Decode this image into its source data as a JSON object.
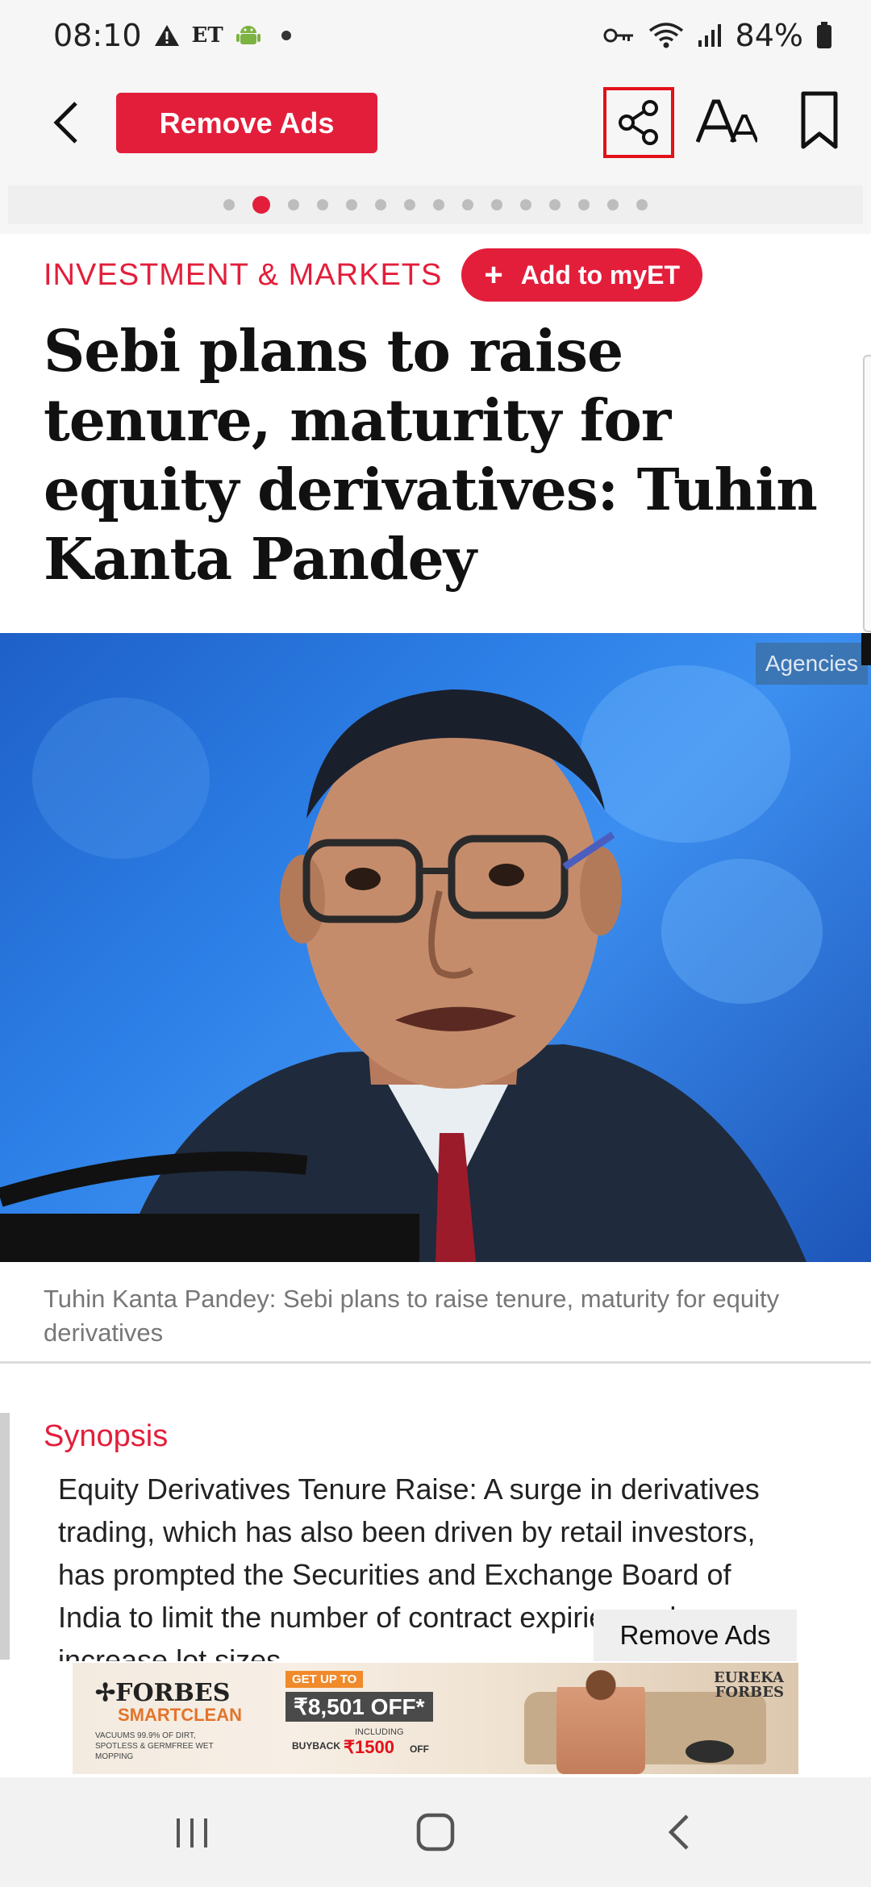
{
  "status_bar": {
    "time": "08:10",
    "et_label": "ET",
    "battery": "84%"
  },
  "toolbar": {
    "remove_ads_label": "Remove Ads",
    "font_size_label": "AA",
    "pager": {
      "total": 15,
      "active_index": 1
    }
  },
  "article": {
    "section": "INVESTMENT & MARKETS",
    "add_myet_label": "Add to myET",
    "headline": "Sebi plans to raise tenure, maturity for equity derivatives: Tuhin Kanta Pandey",
    "image_credit": "Agencies",
    "caption": "Tuhin Kanta Pandey: Sebi plans to raise tenure, maturity for equity derivatives",
    "synopsis_title": "Synopsis",
    "synopsis_text": "Equity Derivatives Tenure Raise: A surge in derivatives trading, which has also been driven by retail investors, has prompted the Securities and Exchange Board of India to limit the number of contract expiries and increase lot sizes"
  },
  "ad": {
    "remove_ads_label": "Remove Ads",
    "brand": "FORBES",
    "sub_brand": "SMARTCLEAN",
    "small_print": "VACUUMS 99.9% OF DIRT, SPOTLESS & GERMFREE WET MOPPING",
    "get_up_to": "GET UP TO",
    "offer": "₹8,501 OFF*",
    "including": "INCLUDING",
    "buyback": "BUYBACK",
    "buyback_amount": "₹1500",
    "buyback_off": "OFF",
    "logo2_line1": "EUREKA",
    "logo2_line2": "FORBES"
  },
  "colors": {
    "accent": "#e31e3b",
    "highlight_border": "#e3101a"
  },
  "icons": {
    "back": "chevron-left-icon",
    "share": "share-icon",
    "font_size": "font-size-icon",
    "bookmark": "bookmark-icon",
    "nav_recents": "recents-icon",
    "nav_home": "home-icon",
    "nav_back": "back-icon"
  }
}
